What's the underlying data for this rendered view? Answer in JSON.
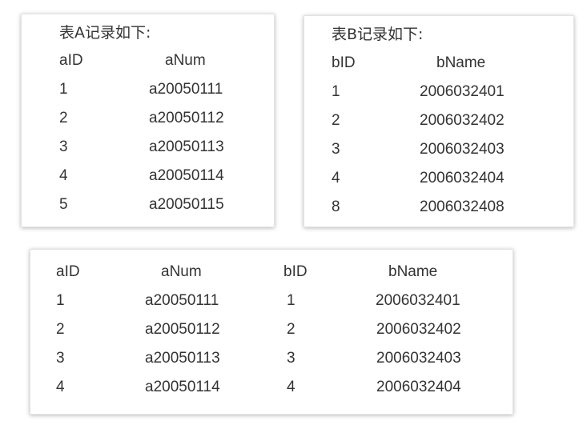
{
  "table_a": {
    "title": "表A记录如下:",
    "headers": [
      "aID",
      "aNum"
    ],
    "rows": [
      [
        "1",
        "a20050111"
      ],
      [
        "2",
        "a20050112"
      ],
      [
        "3",
        "a20050113"
      ],
      [
        "4",
        "a20050114"
      ],
      [
        "5",
        "a20050115"
      ]
    ]
  },
  "table_b": {
    "title": "表B记录如下:",
    "headers": [
      "bID",
      "bName"
    ],
    "rows": [
      [
        "1",
        "2006032401"
      ],
      [
        "2",
        "2006032402"
      ],
      [
        "3",
        "2006032403"
      ],
      [
        "4",
        "2006032404"
      ],
      [
        "8",
        "2006032408"
      ]
    ]
  },
  "join_table": {
    "headers": [
      "aID",
      "aNum",
      "bID",
      "bName"
    ],
    "rows": [
      [
        "1",
        "a20050111",
        "1",
        "2006032401"
      ],
      [
        "2",
        "a20050112",
        "2",
        "2006032402"
      ],
      [
        "3",
        "a20050113",
        "3",
        "2006032403"
      ],
      [
        "4",
        "a20050114",
        "4",
        "2006032404"
      ]
    ]
  },
  "colors": {
    "text": "#333333",
    "card_background": "#ffffff",
    "card_border": "#e3e3e3"
  }
}
